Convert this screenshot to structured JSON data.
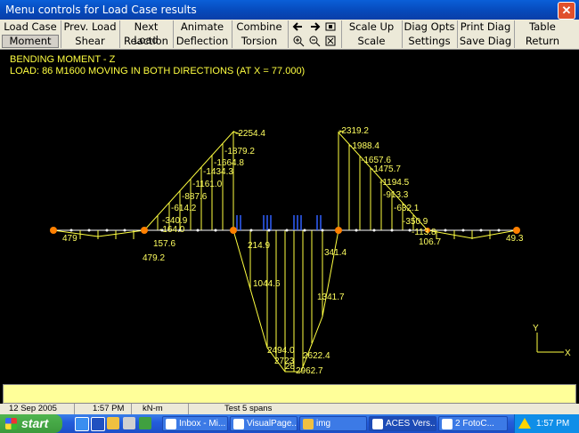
{
  "window": {
    "title": "Menu controls for Load Case results",
    "close_glyph": "✕"
  },
  "menu": {
    "row1": [
      "Load Case",
      "Prev. Load",
      "Next Load",
      "Animate",
      "Combine",
      "Scale Up",
      "Diag Opts",
      "Print Diag",
      "Table"
    ],
    "row2": [
      "Moment",
      "Shear",
      "Reaction",
      "Deflection",
      "Torsion",
      "Scale Down",
      "Settings",
      "Save Diag",
      "Return"
    ],
    "icons": [
      "arrow-left-icon",
      "arrow-right-icon",
      "zoom-fit-icon",
      "zoom-in-icon",
      "zoom-out-icon",
      "zoom-extents-icon"
    ]
  },
  "diagram": {
    "heading": "BENDING MOMENT - Z",
    "load_label": "LOAD:    86 M1600 MOVING IN BOTH DIRECTIONS (AT X = 77.000)",
    "axis_y": "Y",
    "axis_x": "X",
    "labels": [
      "-2254.4",
      "-1879.2",
      "-1664.8",
      "-1434.3",
      "-1161.0",
      "-887.6",
      "-614.2",
      "-340.9",
      "-164.0",
      "157.6",
      "479.2",
      "214.9",
      "1044.6",
      "2494.0",
      "2723",
      "2622.4",
      "2962.7",
      "341.4",
      "1341.7",
      "-2319.2",
      "-1988.4",
      "-1657.6",
      "-1475.7",
      "-1194.5",
      "-913.3",
      "-632.1",
      "-350.9",
      "-113.8",
      "106.7",
      "49.3",
      "479",
      "28"
    ],
    "colors": {
      "diagram": "#ffff40",
      "node": "#ff8000",
      "load": "#3060ff"
    }
  },
  "status": {
    "date": "12 Sep 2005",
    "time": "1:57 PM",
    "units": "kN-m",
    "project": "Test 5 spans"
  },
  "taskbar": {
    "start": "start",
    "tasks": [
      "Inbox - Mi...",
      "VisualPage...",
      "img",
      "ACES Vers...",
      "2 FotoC..."
    ],
    "clock": "1:57 PM"
  }
}
